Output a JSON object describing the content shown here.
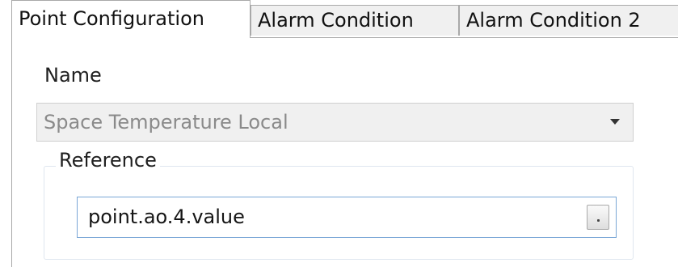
{
  "tabs": [
    {
      "label": "Point Configuration",
      "active": true
    },
    {
      "label": "Alarm Condition",
      "active": false
    },
    {
      "label": "Alarm Condition 2",
      "active": false
    }
  ],
  "name": {
    "label": "Name",
    "value": "Space Temperature Local"
  },
  "reference": {
    "label": "Reference",
    "value": "point.ao.4.value"
  },
  "icons": {
    "dropdown": "chevron-down-icon",
    "browse": "ellipsis-browse-icon"
  },
  "colors": {
    "focus_border": "#7aa7d6",
    "disabled_text": "#8a8a8a",
    "disabled_bg": "#f0f0f0"
  }
}
